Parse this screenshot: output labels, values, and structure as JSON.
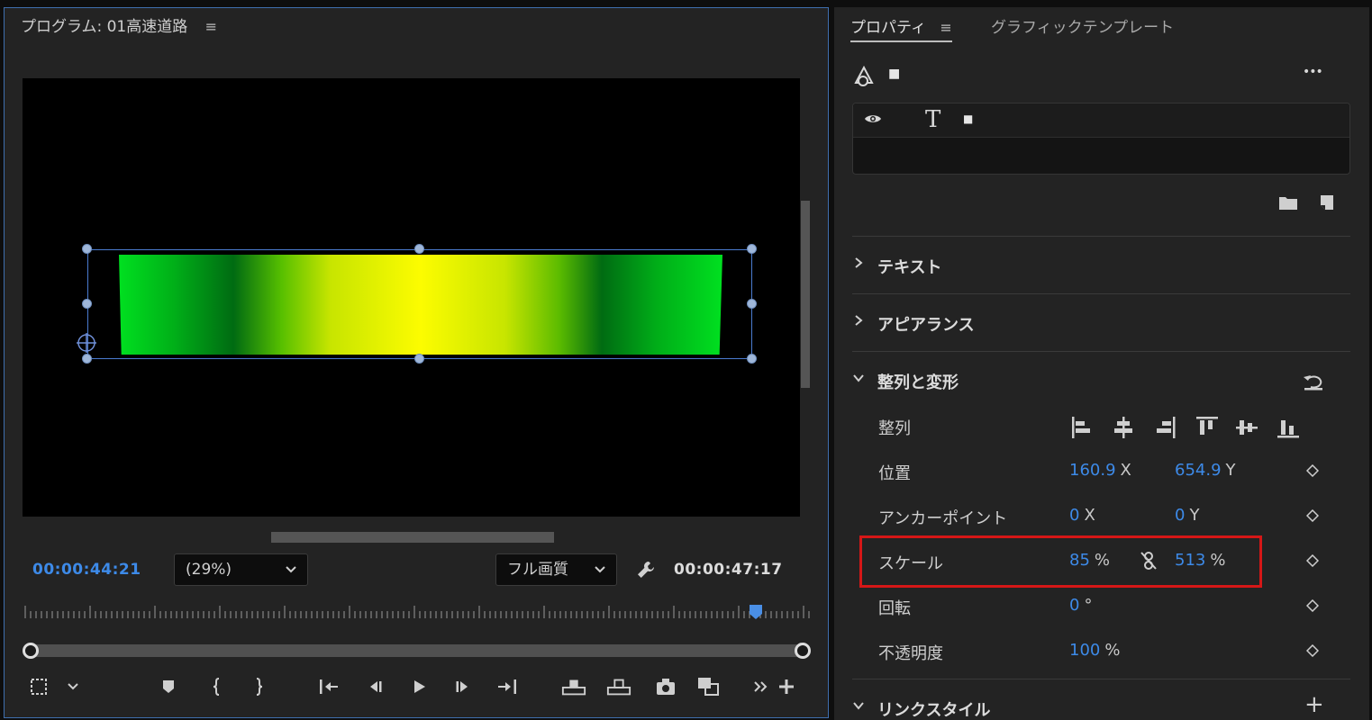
{
  "program": {
    "title": "プログラム: 01高速道路",
    "menu_glyph": "≡",
    "timecode_current": "00:00:44:21",
    "timecode_total": "00:00:47:17",
    "zoom_value": "(29%)",
    "quality_value": "フル画質"
  },
  "props": {
    "tab_properties": "プロパティ",
    "tab_graphic_templates": "グラフィックテンプレート",
    "menu_glyph": "≡",
    "header_shape_glyph": "■",
    "layer_text_glyph": "T",
    "layer_color_glyph": "■",
    "more_glyph": "•••",
    "sections": {
      "text": "テキスト",
      "appearance": "アピアランス",
      "align_transform": "整列と変形",
      "link_style": "リンクスタイル"
    },
    "rows": {
      "align_label": "整列",
      "position_label": "位置",
      "position_x": "160.9",
      "position_x_unit": "X",
      "position_y": "654.9",
      "position_y_unit": "Y",
      "anchor_label": "アンカーポイント",
      "anchor_x": "0",
      "anchor_x_unit": "X",
      "anchor_y": "0",
      "anchor_y_unit": "Y",
      "scale_label": "スケール",
      "scale_w": "85",
      "scale_w_unit": "%",
      "scale_h": "513",
      "scale_h_unit": "%",
      "rotation_label": "回転",
      "rotation_value": "0",
      "rotation_unit": "°",
      "opacity_label": "不透明度",
      "opacity_value": "100",
      "opacity_unit": "%"
    },
    "plus_glyph": "+"
  },
  "colors": {
    "accent_blue": "#3d8ae8",
    "highlight_red": "#d51717",
    "panel_bg": "#232323"
  }
}
